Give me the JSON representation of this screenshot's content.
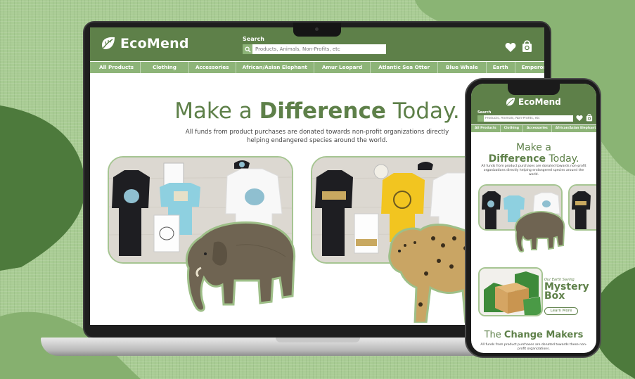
{
  "colors": {
    "brand_dark": "#5e8049",
    "brand_light": "#8db478",
    "card_border": "#a6c592",
    "background": "#a9cc94"
  },
  "brand": {
    "name": "EcoMend",
    "logo_icon": "leaf-icon"
  },
  "search": {
    "label": "Search",
    "placeholder": "Products, Animals, Non-Profits, etc"
  },
  "header_icons": [
    "heart-icon",
    "shopping-bag-icon",
    "search-icon"
  ],
  "nav": {
    "items": [
      "All Products",
      "Clothing",
      "Accessories",
      "African/Asian Elephant",
      "Amur Leopard",
      "Atlantic Sea Otter",
      "Blue Whale",
      "Earth",
      "Emperor Penguin"
    ]
  },
  "hero": {
    "title_pre": "Make a ",
    "title_bold": "Difference",
    "title_post": " Today.",
    "subtitle": "All funds from product purchases are donated towards non-profit organizations directly helping endangered species around the world."
  },
  "mobile_nav": {
    "items": [
      "All Products",
      "Clothing",
      "Accessories",
      "African/Asian Elephant"
    ]
  },
  "mystery_box": {
    "kicker": "Our Earth Saving",
    "title": "Mystery Box",
    "button": "Learn More"
  },
  "change_makers": {
    "title_pre": "The ",
    "title_bold": "Change Makers",
    "subtitle": "All funds from product purchases are donated towards these non-profit organizations."
  }
}
